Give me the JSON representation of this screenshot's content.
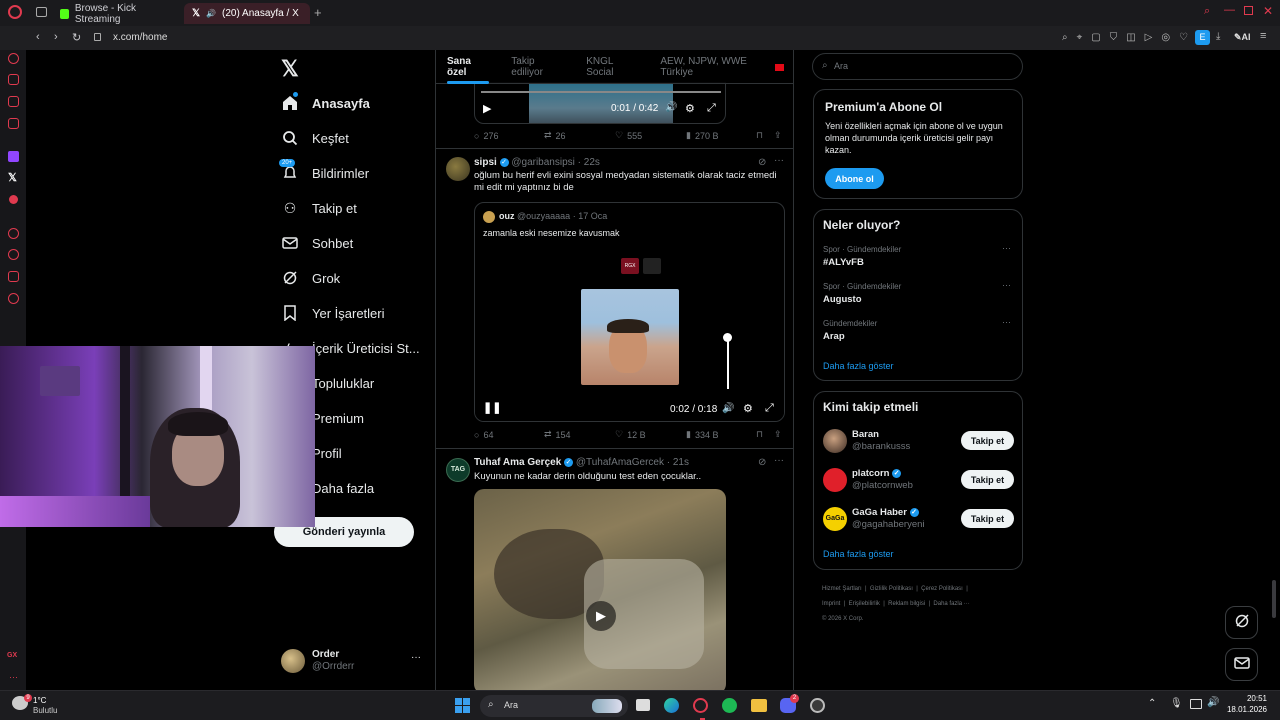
{
  "browser": {
    "tabs": [
      {
        "title": "Browse - Kick Streaming"
      },
      {
        "title": "(20) Anasayfa / X"
      }
    ],
    "url": "x.com/home",
    "ai_label": "AI",
    "profile_badge": "E"
  },
  "x_nav": {
    "items": [
      {
        "label": "Anasayfa"
      },
      {
        "label": "Keşfet"
      },
      {
        "label": "Bildirimler",
        "badge": "20+"
      },
      {
        "label": "Takip et"
      },
      {
        "label": "Sohbet"
      },
      {
        "label": "Grok"
      },
      {
        "label": "Yer İşaretleri"
      },
      {
        "label": "İçerik Üreticisi St..."
      },
      {
        "label": "Topluluklar"
      },
      {
        "label": "Premium"
      },
      {
        "label": "Profil"
      },
      {
        "label": "Daha fazla"
      }
    ],
    "post_button": "Gönderi yayınla",
    "account": {
      "name": "Order",
      "handle": "@Orrderr"
    }
  },
  "timeline": {
    "tabs": [
      "Sana özel",
      "Takip ediliyor",
      "KNGL Social",
      "AEW, NJPW, WWE Türkiye"
    ],
    "video1": {
      "time": "0:01 / 0:42"
    },
    "stats1": {
      "replies": "276",
      "reposts": "26",
      "likes": "555",
      "views": "270 B"
    },
    "post2": {
      "name": "sipsi",
      "handle": "@garibansipsi",
      "time": "· 22s",
      "text": "oğlum bu herif evli exini sosyal medyadan sistematik olarak taciz etmedi mi edit mi yaptınız bi de",
      "quote": {
        "name": "ouz",
        "handle": "@ouzyaaaaa",
        "time": "· 17 Oca",
        "text": "zamanla eski nesemize kavusmak",
        "badge": "RGX"
      },
      "video_time": "0:02 / 0:18",
      "stats": {
        "replies": "64",
        "reposts": "154",
        "likes": "12 B",
        "views": "334 B"
      }
    },
    "post3": {
      "avatar_text": "TAG",
      "name": "Tuhaf Ama Gerçek",
      "handle": "@TuhafAmaGercek",
      "time": "· 21s",
      "text": "Kuyunun ne kadar derin olduğunu test eden çocuklar.."
    }
  },
  "right": {
    "search_placeholder": "Ara",
    "premium": {
      "title": "Premium'a Abone Ol",
      "body": "Yeni özellikleri açmak için abone ol ve uygun olman durumunda içerik üreticisi gelir payı kazan.",
      "button": "Abone ol"
    },
    "trends": {
      "title": "Neler oluyor?",
      "items": [
        {
          "context": "Spor · Gündemdekiler",
          "topic": "#ALYvFB"
        },
        {
          "context": "Spor · Gündemdekiler",
          "topic": "Augusto"
        },
        {
          "context": "Gündemdekiler",
          "topic": "Arap"
        }
      ],
      "more": "Daha fazla göster"
    },
    "who_to_follow": {
      "title": "Kimi takip etmeli",
      "items": [
        {
          "name": "Baran",
          "handle": "@barankusss",
          "verified": false
        },
        {
          "name": "platcorn",
          "handle": "@platcornweb",
          "verified": true
        },
        {
          "name": "GaGa Haber",
          "handle": "@gagahaberyeni",
          "verified": true
        }
      ],
      "follow_label": "Takip et",
      "more": "Daha fazla göster"
    },
    "footer": {
      "links": [
        "Hizmet Şartları",
        "Gizlilik Politikası",
        "Çerez Politikası",
        "Imprint",
        "Erişilebilirlik",
        "Reklam bilgisi",
        "Daha fazla ···"
      ],
      "copyright": "© 2026 X Corp."
    }
  },
  "taskbar": {
    "weather_temp": "1°C",
    "weather_desc": "Bulutlu",
    "search": "Ara",
    "time": "20:51",
    "date": "18.01.2026",
    "discord_badge": "2"
  },
  "colors": {
    "accent": "#1d9bf0",
    "opera_red": "#e03a4f",
    "kick_green": "#53fc18"
  }
}
